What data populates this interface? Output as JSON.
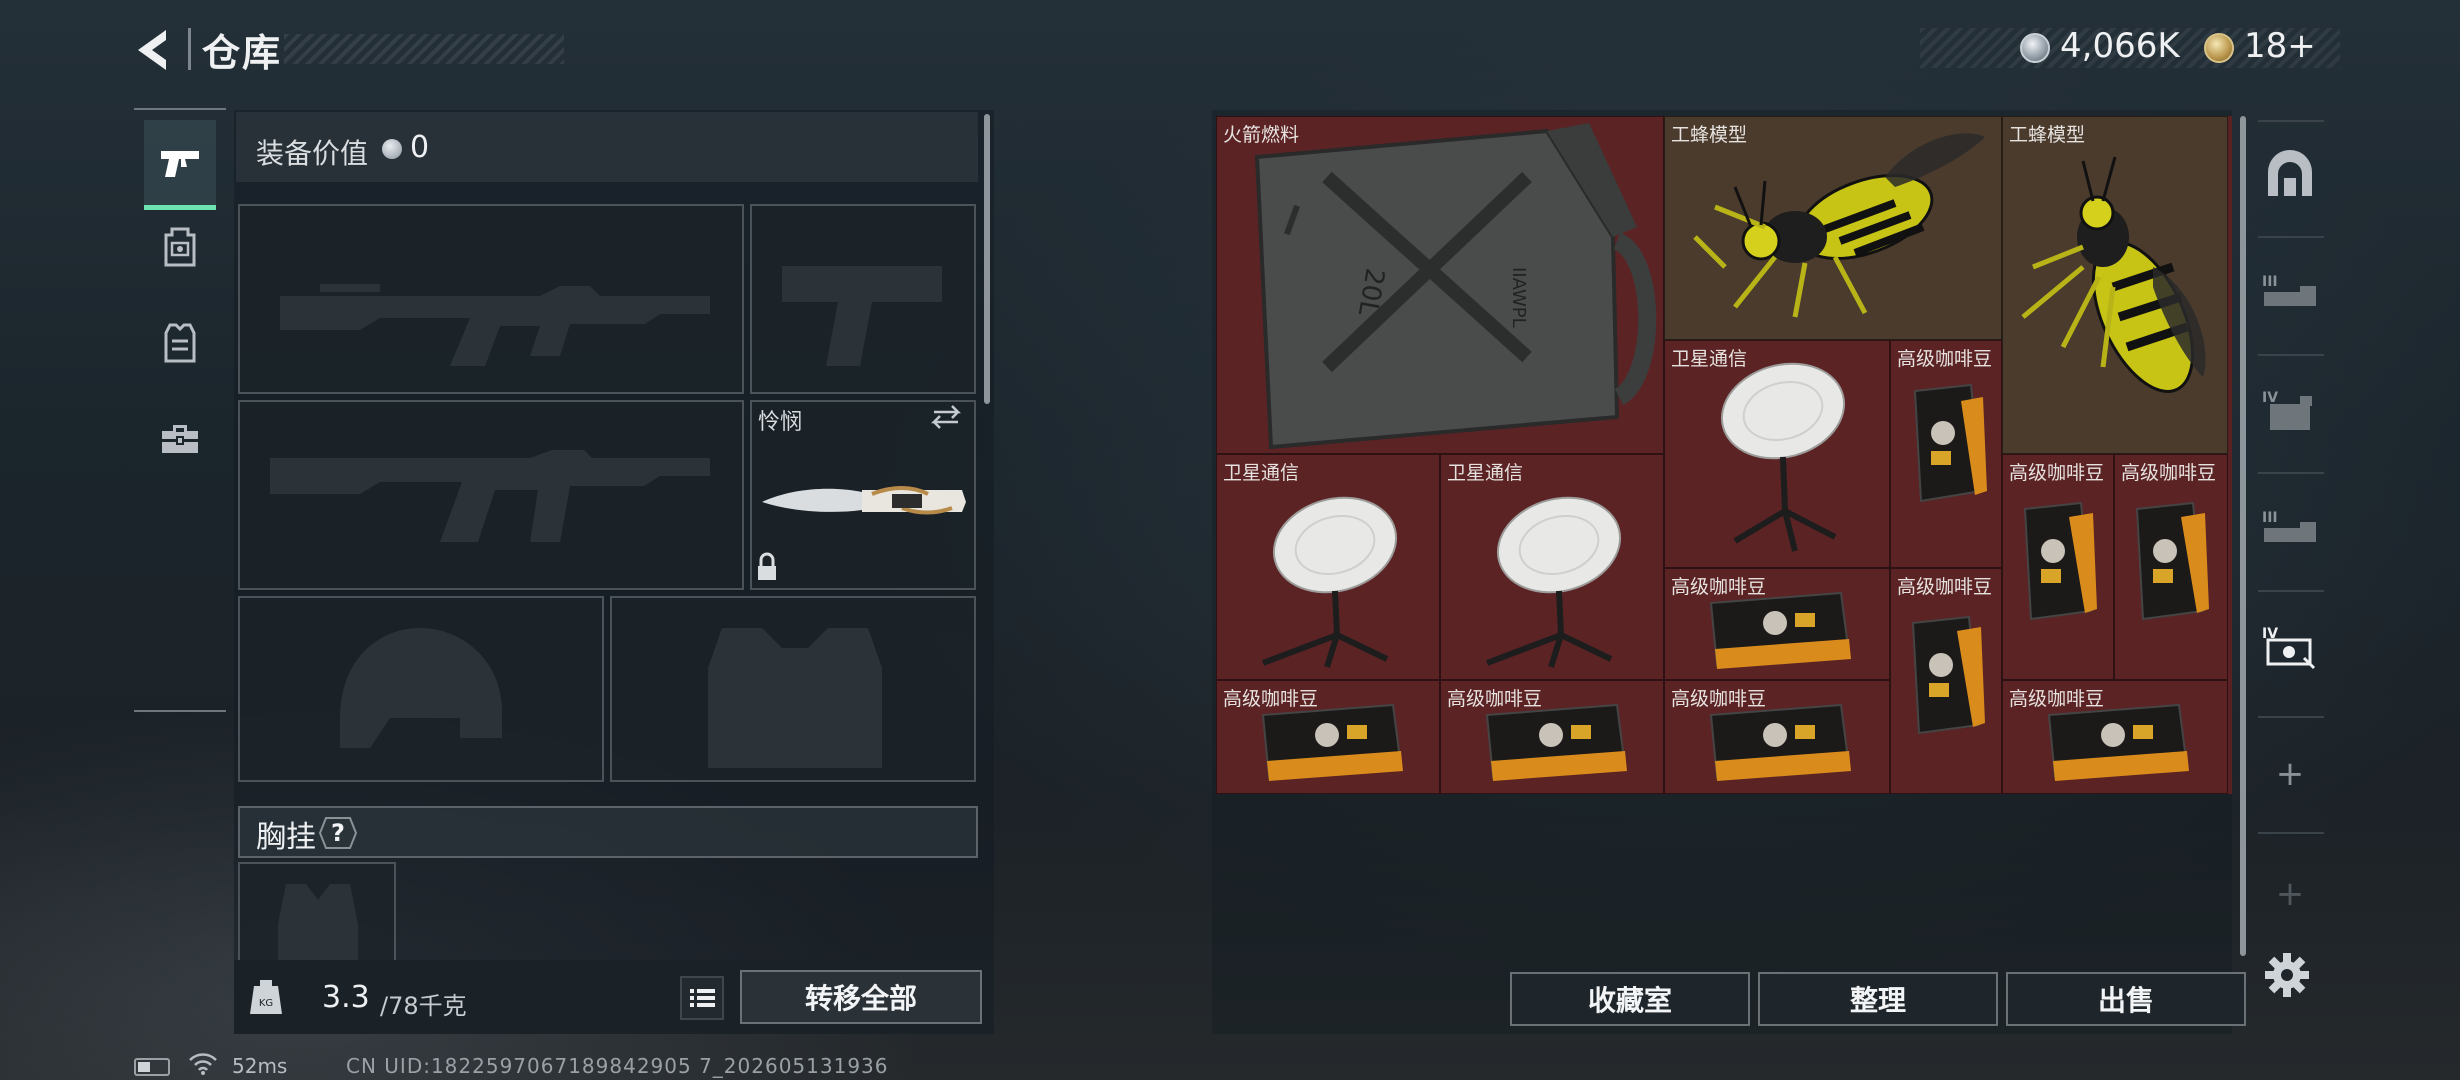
{
  "header": {
    "title": "仓库",
    "cash": "4,066K",
    "tickets": "18+"
  },
  "left_nav": {
    "items": [
      {
        "icon": "pistol-icon",
        "active": true
      },
      {
        "icon": "backpack-icon",
        "active": false
      },
      {
        "icon": "rig-icon",
        "active": false
      },
      {
        "icon": "toolbox-icon",
        "active": false
      }
    ]
  },
  "loadout": {
    "equip_value_label": "装备价值",
    "equip_value": "0",
    "melee_name": "怜悯",
    "rig_label": "胸挂",
    "rig_help": "?"
  },
  "weight": {
    "current": "3.3",
    "max": "/78千克"
  },
  "buttons": {
    "transfer_all": "转移全部",
    "collection": "收藏室",
    "sort": "整理",
    "sell": "出售"
  },
  "stash": {
    "items": [
      {
        "name": "火箭燃料",
        "icon": "jerrycan-icon"
      },
      {
        "name": "工蜂模型",
        "icon": "wasp-model-icon"
      },
      {
        "name": "工蜂模型",
        "icon": "wasp-model-icon"
      },
      {
        "name": "卫星通信",
        "icon": "satellite-dish-icon"
      },
      {
        "name": "高级咖啡豆",
        "icon": "coffee-bag-icon"
      },
      {
        "name": "卫星通信",
        "icon": "satellite-dish-icon"
      },
      {
        "name": "卫星通信",
        "icon": "satellite-dish-icon"
      },
      {
        "name": "高级咖啡豆",
        "icon": "coffee-bag-icon"
      },
      {
        "name": "高级咖啡豆",
        "icon": "coffee-bag-icon"
      },
      {
        "name": "高级咖啡豆",
        "icon": "coffee-bag-icon"
      },
      {
        "name": "高级咖啡豆",
        "icon": "coffee-bag-icon"
      },
      {
        "name": "高级咖啡豆",
        "icon": "coffee-bag-icon"
      },
      {
        "name": "高级咖啡豆",
        "icon": "coffee-bag-icon"
      },
      {
        "name": "高级咖啡豆",
        "icon": "coffee-bag-icon"
      },
      {
        "name": "高级咖啡豆",
        "icon": "coffee-bag-icon"
      }
    ]
  },
  "right_nav": {
    "items": [
      {
        "icon": "safehouse-icon"
      },
      {
        "icon": "stash-tab-3-icon",
        "label": "III"
      },
      {
        "icon": "stash-tab-4-icon",
        "label": "IV"
      },
      {
        "icon": "stash-tab-3b-icon",
        "label": "III"
      },
      {
        "icon": "stash-tab-4b-icon",
        "label": "IV"
      },
      {
        "icon": "add-icon",
        "label": "+"
      },
      {
        "icon": "add-icon",
        "label": "+"
      }
    ]
  },
  "status": {
    "ping": "52ms",
    "uid": "CN UID:1822597067189842905 7_202605131936"
  },
  "colors": {
    "accent": "#6ee3b2",
    "stash_cell": "#5c2325",
    "wasp_cell": "#4b3b2d"
  }
}
